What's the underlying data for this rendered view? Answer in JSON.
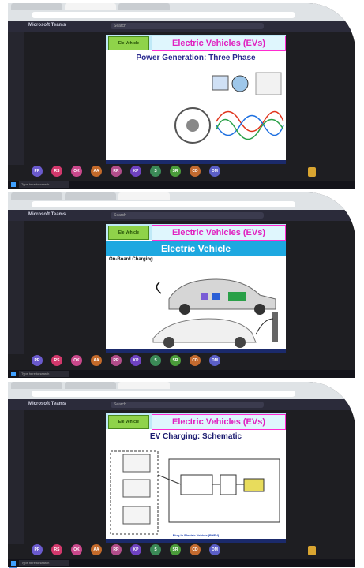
{
  "app": {
    "name": "Microsoft Teams",
    "search_placeholder": "Search"
  },
  "slides": [
    {
      "header": "Electric Vehicles (EVs)",
      "title": "Power Generation: Three Phase"
    },
    {
      "header": "Electric Vehicles (EVs)",
      "title": "Electric Vehicle",
      "subtitle": "On-Board Charging"
    },
    {
      "header": "Electric Vehicles (EVs)",
      "title": "EV Charging: Schematic",
      "caption": "Plug In Electric Vehicle (PHEV)"
    }
  ],
  "logo_text": "Ele Vehicle",
  "taskbar": {
    "search_placeholder": "Type here to search"
  },
  "colors": {
    "accent": "#e020c0",
    "banner": "#bfe9f7",
    "title_bar": "#1ea8e0"
  },
  "participants": [
    {
      "initials": "PR",
      "color": "#6a5acd"
    },
    {
      "initials": "RS",
      "color": "#d2386c"
    },
    {
      "initials": "OK",
      "color": "#c9488b"
    },
    {
      "initials": "AA",
      "color": "#c46a2a"
    },
    {
      "initials": "RR",
      "color": "#b24d8a"
    },
    {
      "initials": "KP",
      "color": "#6f42c1"
    },
    {
      "initials": "S",
      "color": "#3b8a57"
    },
    {
      "initials": "SR",
      "color": "#4a9c3a"
    },
    {
      "initials": "CD",
      "color": "#c36a2f"
    },
    {
      "initials": "DM",
      "color": "#5b5fc7"
    }
  ]
}
